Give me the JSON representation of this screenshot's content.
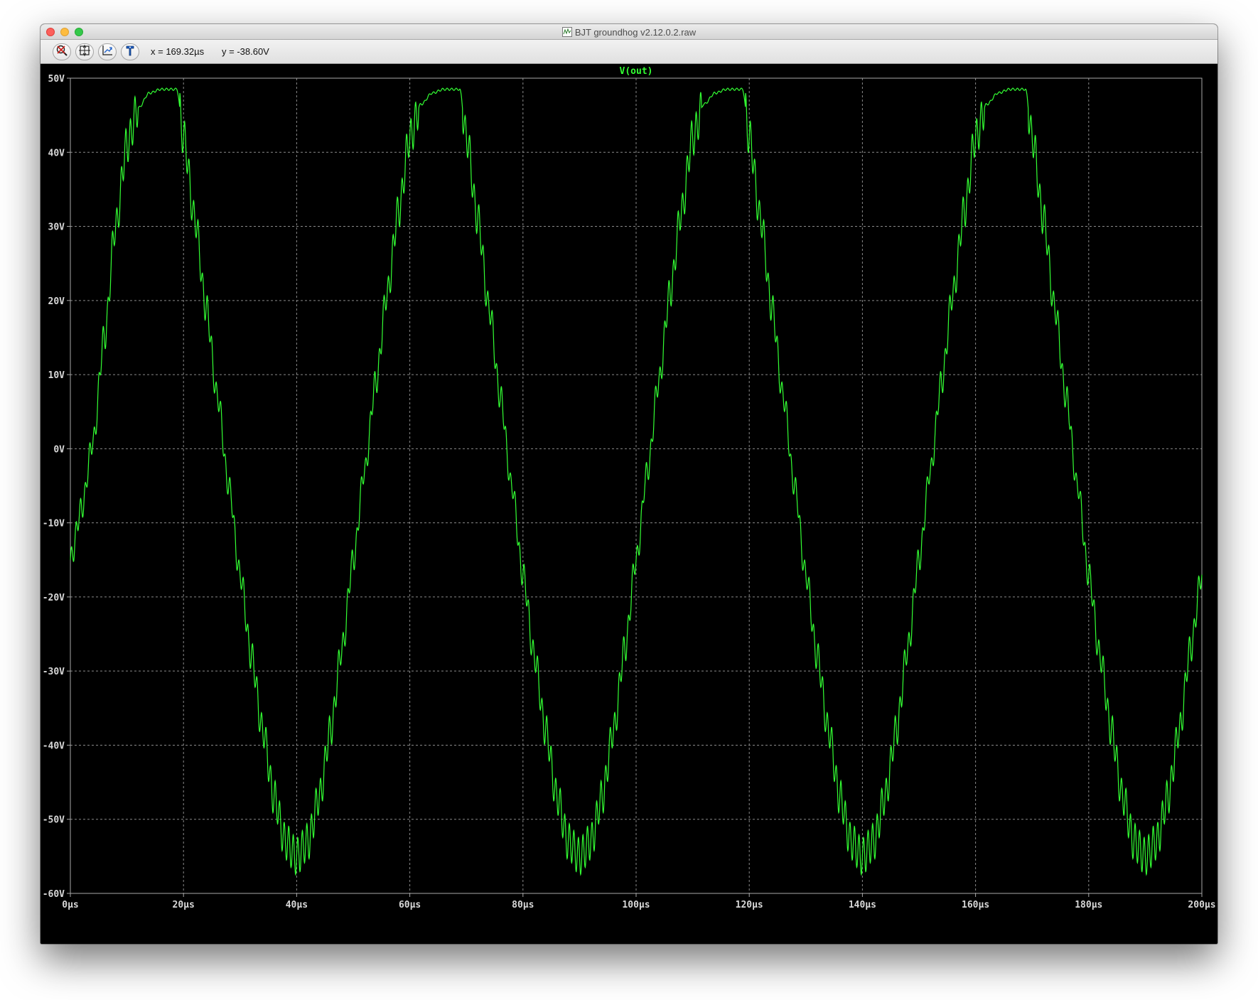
{
  "window": {
    "title": "BJT groundhog v2.12.0.2.raw"
  },
  "toolbar": {
    "buttons": [
      {
        "name": "autorange-button",
        "icon": "zoom-cancel-icon"
      },
      {
        "name": "zoom-area-button",
        "icon": "zoom-area-icon"
      },
      {
        "name": "pan-button",
        "icon": "pan-icon"
      },
      {
        "name": "probe-button",
        "icon": "probe-icon"
      }
    ],
    "x_readout": "x = 169.32µs",
    "y_readout": "y = -38.60V"
  },
  "colors": {
    "trace": "#33ff33",
    "grid": "#8a8a8a",
    "axis_text": "#d8d8d8",
    "background": "#000000"
  },
  "chart_data": {
    "type": "line",
    "title": "V(out)",
    "xlabel": "",
    "ylabel": "",
    "xlim": [
      0,
      200
    ],
    "ylim": [
      -60,
      50
    ],
    "grid": true,
    "x_ticks": [
      "0µs",
      "20µs",
      "40µs",
      "60µs",
      "80µs",
      "100µs",
      "120µs",
      "140µs",
      "160µs",
      "180µs",
      "200µs"
    ],
    "y_ticks": [
      "50V",
      "40V",
      "30V",
      "20V",
      "10V",
      "0V",
      "-10V",
      "-20V",
      "-30V",
      "-40V",
      "-50V",
      "-60V"
    ],
    "x_tick_values": [
      0,
      20,
      40,
      60,
      80,
      100,
      120,
      140,
      160,
      180,
      200
    ],
    "y_tick_values": [
      50,
      40,
      30,
      20,
      10,
      0,
      -10,
      -20,
      -30,
      -40,
      -50,
      -60
    ],
    "series": [
      {
        "name": "V(out)",
        "x_unit": "µs",
        "y_unit": "V",
        "x": [
          0,
          2,
          4,
          6,
          8,
          10,
          12,
          14,
          16,
          18,
          18.8,
          20,
          22,
          24,
          26,
          28,
          30,
          32,
          34,
          36,
          38,
          40,
          42,
          44,
          46,
          48,
          50,
          52,
          54,
          56,
          58,
          60,
          62,
          64,
          66,
          68,
          68.8,
          70,
          72,
          74,
          76,
          78,
          80,
          82,
          84,
          86,
          88,
          90,
          92,
          94,
          96,
          98,
          100,
          102,
          104,
          106,
          108,
          110,
          112,
          114,
          116,
          118,
          118.8,
          120,
          122,
          124,
          126,
          128,
          130,
          132,
          134,
          136,
          138,
          140,
          142,
          144,
          146,
          148,
          150,
          152,
          154,
          156,
          158,
          160,
          162,
          164,
          166,
          168,
          168.8,
          170,
          172,
          174,
          176,
          178,
          180,
          182,
          184,
          186,
          188,
          190,
          192,
          194,
          196,
          198,
          200
        ],
        "y": [
          -15,
          -8,
          1,
          15,
          30,
          41,
          46,
          48,
          48.5,
          48.5,
          48.5,
          42,
          31,
          19,
          7,
          -5,
          -17,
          -28,
          -38,
          -47,
          -53,
          -55,
          -53,
          -47,
          -38,
          -27,
          -15,
          -3,
          9,
          21,
          32,
          42,
          46.5,
          48,
          48.5,
          48.5,
          48.5,
          42,
          31,
          19,
          7,
          -5,
          -17,
          -28,
          -38,
          -47,
          -53,
          -55,
          -53,
          -47,
          -38,
          -27,
          -15,
          -3,
          9,
          21,
          32,
          42,
          46.5,
          48,
          48.5,
          48.5,
          48.5,
          42,
          31,
          19,
          7,
          -5,
          -17,
          -28,
          -38,
          -47,
          -53,
          -55,
          -53,
          -47,
          -38,
          -27,
          -15,
          -3,
          9,
          21,
          32,
          42,
          46.5,
          48,
          48.5,
          48.5,
          48.5,
          42,
          31,
          19,
          7,
          -5,
          -17,
          -28,
          -38,
          -47,
          -53,
          -55,
          -53,
          -47,
          -38,
          -27,
          -17
        ],
        "ripple_amplitude_v": 2.5,
        "ripple_period_us": 0.8
      }
    ]
  }
}
